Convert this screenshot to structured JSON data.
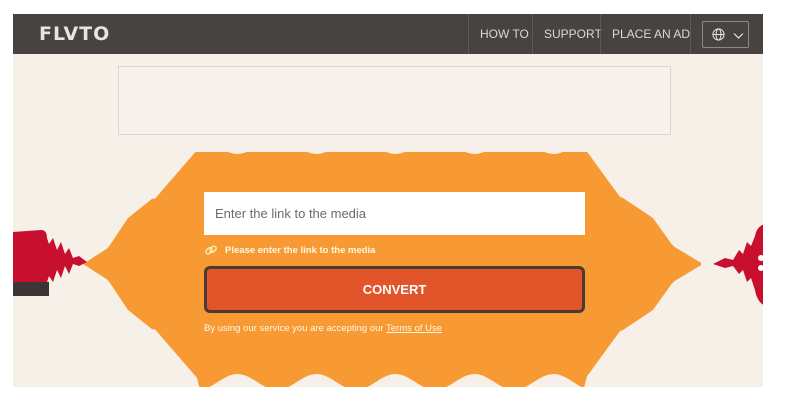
{
  "header": {
    "logo": "FLVTO",
    "nav": {
      "how_to": "HOW TO",
      "support": "SUPPORT",
      "place_ad": "PLACE AN AD"
    },
    "language_icon": "globe-icon",
    "dropdown_icon": "chevron-down-icon"
  },
  "converter": {
    "input_placeholder": "Enter the link to the media",
    "hint_icon": "link-icon",
    "hint_text": "Please enter the link to the media",
    "convert_label": "CONVERT",
    "terms_prefix": "By using our service you are accepting our ",
    "terms_link": "Terms of Use"
  },
  "colors": {
    "header_bg": "#474340",
    "page_bg": "#f6f0e9",
    "wave": "#f79a34",
    "convert": "#e25429",
    "accent_red": "#c8102e"
  }
}
